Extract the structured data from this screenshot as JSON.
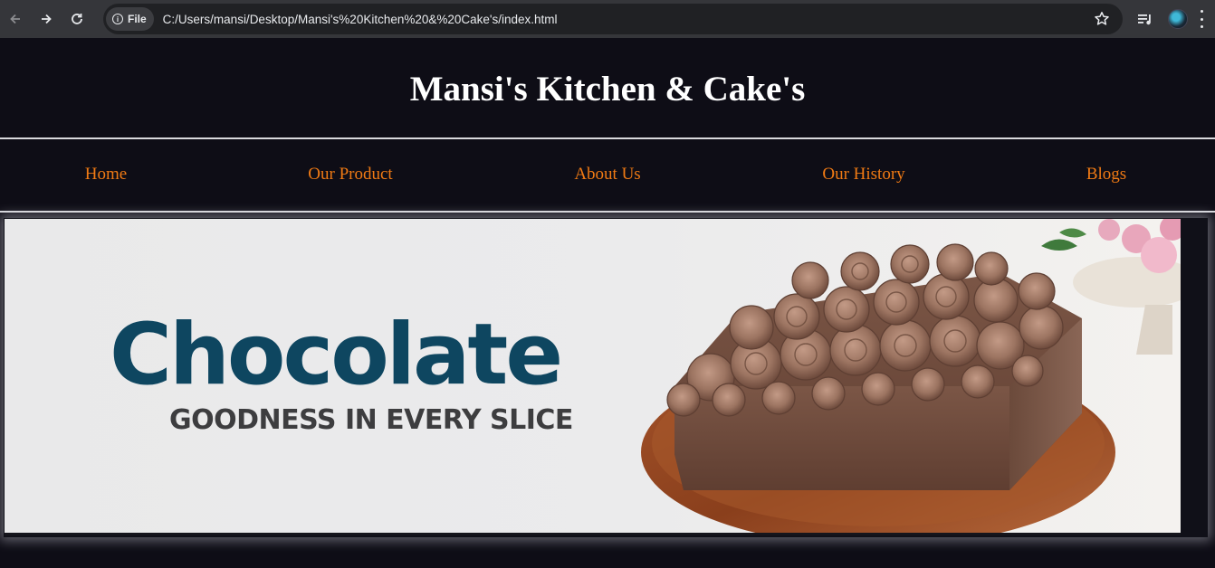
{
  "browser": {
    "chip_label": "File",
    "url": "C:/Users/mansi/Desktop/Mansi's%20Kitchen%20&%20Cake's/index.html",
    "icons": [
      "back-arrow-icon",
      "forward-arrow-icon",
      "reload-icon",
      "info-icon",
      "bookmark-star-icon",
      "media-playlist-icon",
      "profile-avatar",
      "menu-kebab-icon"
    ]
  },
  "site": {
    "title": "Mansi's Kitchen & Cake's",
    "nav": [
      {
        "label": "Home"
      },
      {
        "label": "Our Product"
      },
      {
        "label": "About Us"
      },
      {
        "label": "Our History"
      },
      {
        "label": "Blogs"
      }
    ],
    "colors": {
      "background": "#0e0d16",
      "nav_link": "#f07a14",
      "title": "#ffffff"
    }
  },
  "banner": {
    "heading": "Chocolate",
    "subheading": "GOODNESS IN EVERY SLICE",
    "image": "chocolate-cake-photo",
    "colors": {
      "heading": "#0e4660",
      "subheading": "#3d3d3f"
    }
  }
}
